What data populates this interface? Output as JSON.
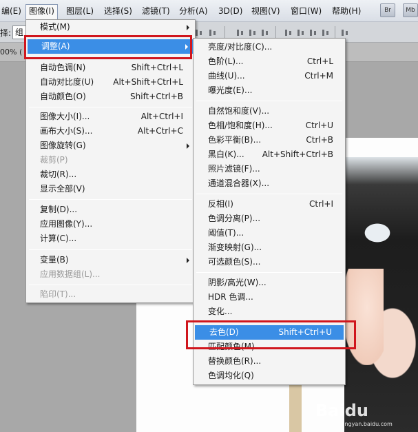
{
  "menubar": {
    "items": [
      "编(E)",
      "图像(I)",
      "图层(L)",
      "选择(S)",
      "滤镜(T)",
      "分析(A)",
      "3D(D)",
      "视图(V)",
      "窗口(W)",
      "帮助(H)"
    ],
    "app_buttons": [
      "Br",
      "Mb"
    ]
  },
  "options_bar": {
    "label": "择:",
    "field_value": "组"
  },
  "doc_strip": {
    "zoom": "00% ("
  },
  "image_menu": {
    "mode": "模式(M)",
    "adjust": "调整(A)",
    "auto_tone": "自动色调(N)",
    "auto_tone_sc": "Shift+Ctrl+L",
    "auto_contrast": "自动对比度(U)",
    "auto_contrast_sc": "Alt+Shift+Ctrl+L",
    "auto_color": "自动颜色(O)",
    "auto_color_sc": "Shift+Ctrl+B",
    "image_size": "图像大小(I)...",
    "image_size_sc": "Alt+Ctrl+I",
    "canvas_size": "画布大小(S)...",
    "canvas_size_sc": "Alt+Ctrl+C",
    "rotate": "图像旋转(G)",
    "crop": "裁剪(P)",
    "trim": "裁切(R)...",
    "reveal_all": "显示全部(V)",
    "duplicate": "复制(D)...",
    "apply_image": "应用图像(Y)...",
    "calculations": "计算(C)...",
    "variables": "变量(B)",
    "apply_dataset": "应用数据组(L)...",
    "trap": "陷印(T)..."
  },
  "adjust_menu": {
    "brightness": "亮度/对比度(C)...",
    "levels": "色阶(L)...",
    "levels_sc": "Ctrl+L",
    "curves": "曲线(U)...",
    "curves_sc": "Ctrl+M",
    "exposure": "曝光度(E)...",
    "vibrance": "自然饱和度(V)...",
    "hue_sat": "色相/饱和度(H)...",
    "hue_sat_sc": "Ctrl+U",
    "color_balance": "色彩平衡(B)...",
    "color_balance_sc": "Ctrl+B",
    "bw": "黑白(K)...",
    "bw_sc": "Alt+Shift+Ctrl+B",
    "photo_filter": "照片滤镜(F)...",
    "channel_mixer": "通道混合器(X)...",
    "invert": "反相(I)",
    "invert_sc": "Ctrl+I",
    "posterize": "色调分离(P)...",
    "threshold": "阈值(T)...",
    "gradient_map": "渐变映射(G)...",
    "selective_color": "可选颜色(S)...",
    "shadows": "阴影/高光(W)...",
    "hdr": "HDR 色调...",
    "variations": "变化...",
    "desaturate": "去色(D)",
    "desaturate_sc": "Shift+Ctrl+U",
    "match_color": "匹配颜色(M)...",
    "replace_color": "替换颜色(R)...",
    "equalize": "色调均化(Q)"
  },
  "watermark": {
    "logo": "Baidu",
    "sub": "jingyan.baidu.com"
  },
  "colors": {
    "highlight": "#3b8ee6",
    "annotation_red": "#d0161d"
  }
}
